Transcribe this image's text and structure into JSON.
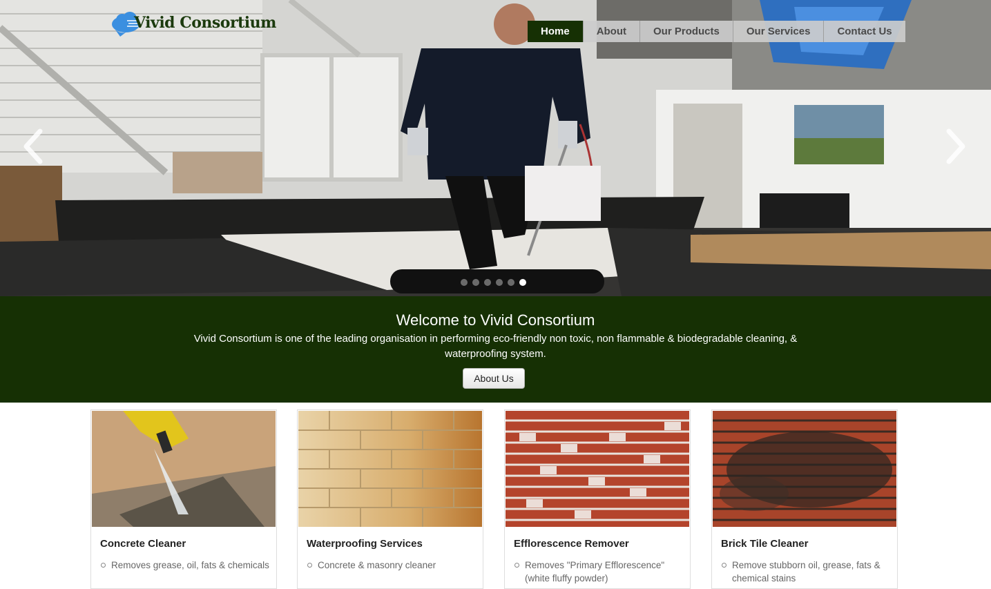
{
  "brand": {
    "name": "Vivid Consortium"
  },
  "nav": {
    "items": [
      {
        "label": "Home",
        "active": true
      },
      {
        "label": "About"
      },
      {
        "label": "Our Products"
      },
      {
        "label": "Our Services"
      },
      {
        "label": "Contact Us"
      }
    ]
  },
  "slider": {
    "slide_count": 6,
    "active_slide": 6,
    "prev_icon": "chevron-left-icon",
    "next_icon": "chevron-right-icon"
  },
  "welcome": {
    "title": "Welcome to Vivid Consortium",
    "text": "Vivid Consortium is one of the leading organisation in performing eco-friendly non toxic, non flammable & biodegradable cleaning, & waterproofing system.",
    "button_label": "About Us"
  },
  "cards": [
    {
      "title": "Concrete Cleaner",
      "items": [
        "Removes grease, oil, fats & chemicals"
      ]
    },
    {
      "title": "Waterproofing Services",
      "items": [
        "Concrete & masonry cleaner"
      ]
    },
    {
      "title": "Efflorescence Remover",
      "items": [
        "Removes \"Primary Efflorescence\" (white fluffy powder)"
      ]
    },
    {
      "title": "Brick Tile Cleaner",
      "items": [
        "Remove stubborn oil, grease, fats & chemical stains"
      ]
    }
  ],
  "colors": {
    "brand_green": "#163004",
    "nav_bg": "#cccccc",
    "nav_text": "#4a4a4a"
  }
}
